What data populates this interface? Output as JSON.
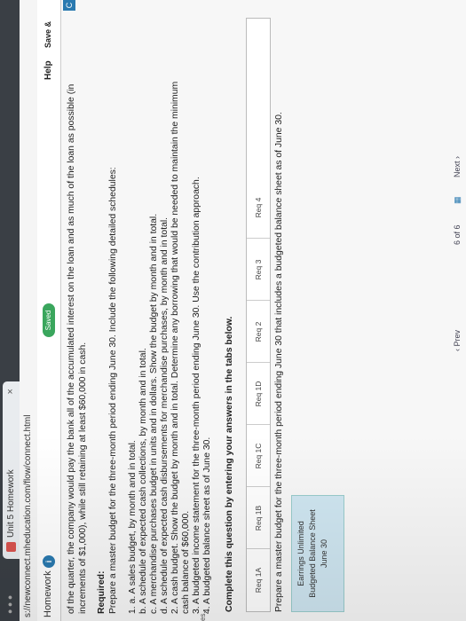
{
  "browser": {
    "tab_title": "Unit 5 Homework",
    "tab_close": "×",
    "window_controls": "● ● ●",
    "url": "s://newconnect.mheducation.com/flow/connect.html"
  },
  "header": {
    "title": "Homework",
    "info": "i",
    "saved": "Saved",
    "help": "Help",
    "save_exit": "Save &"
  },
  "side_button": "C",
  "problem": {
    "line1": "of the quarter, the company would pay the bank all of the accumulated interest on the loan and as much of the loan as possible (in",
    "line2": "increments of $1,000), while still retaining at least $60,000 in cash.",
    "required": "Required:",
    "prepare": "Prepare a master budget for the three-month period ending June 30. Include the following detailed schedules:",
    "items": [
      "1. a. A sales budget, by month and in total.",
      "b. A schedule of expected cash collections, by month and in total.",
      "c. A merchandise purchases budget in units and in dollars. Show the budget by month and in total.",
      "d. A schedule of expected cash disbursements for merchandise purchases, by month and in total.",
      "2. A cash budget. Show the budget by month and in total. Determine any borrowing that would be needed to maintain the minimum",
      "cash balance of $60,000.",
      "3. A budgeted income statement for the three-month period ending June 30. Use the contribution approach.",
      "4. A budgeted balance sheet as of June 30."
    ],
    "left_fragment": "es."
  },
  "question": {
    "instruction": "Complete this question by entering your answers in the tabs below.",
    "tabs": [
      "Req 1A",
      "Req 1B",
      "Req 1C",
      "Req 1D",
      "Req 2",
      "Req 3",
      "Req 4"
    ],
    "prompt": "Prepare a master budget for the three-month period ending June 30 that includes a budgeted balance sheet as of June 30.",
    "company": "Earrings Unlimited",
    "statement": "Budgeted Balance Sheet",
    "date": "June 30"
  },
  "footer": {
    "prev": "‹ Prev",
    "page": "6 of 6",
    "grid_icon": "▦",
    "next": "Next ›"
  }
}
